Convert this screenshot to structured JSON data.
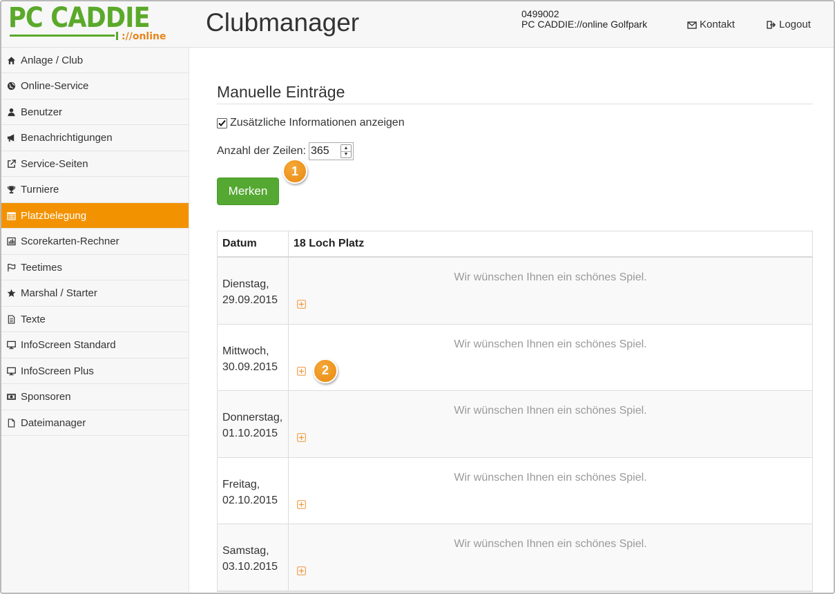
{
  "header": {
    "logo_main": "PC CADDIE",
    "logo_sub": "://online",
    "app_title": "Clubmanager",
    "club_id": "0499002",
    "club_name": "PC CADDIE://online Golfpark",
    "contact_label": "Kontakt",
    "logout_label": "Logout"
  },
  "sidebar": {
    "items": [
      {
        "label": "Anlage / Club",
        "icon": "home-icon"
      },
      {
        "label": "Online-Service",
        "icon": "globe-icon"
      },
      {
        "label": "Benutzer",
        "icon": "user-icon"
      },
      {
        "label": "Benachrichtigungen",
        "icon": "bullhorn-icon"
      },
      {
        "label": "Service-Seiten",
        "icon": "external-link-icon"
      },
      {
        "label": "Turniere",
        "icon": "trophy-icon"
      },
      {
        "label": "Platzbelegung",
        "icon": "calendar-icon",
        "active": true
      },
      {
        "label": "Scorekarten-Rechner",
        "icon": "bar-chart-icon"
      },
      {
        "label": "Teetimes",
        "icon": "flag-icon"
      },
      {
        "label": "Marshal / Starter",
        "icon": "star-icon"
      },
      {
        "label": "Texte",
        "icon": "document-icon"
      },
      {
        "label": "InfoScreen Standard",
        "icon": "monitor-icon"
      },
      {
        "label": "InfoScreen Plus",
        "icon": "monitor-icon"
      },
      {
        "label": "Sponsoren",
        "icon": "money-icon"
      },
      {
        "label": "Dateimanager",
        "icon": "file-icon"
      }
    ]
  },
  "main": {
    "title": "Manuelle Einträge",
    "show_info_label": "Zusätzliche Informationen anzeigen",
    "show_info_checked": true,
    "rows_label": "Anzahl der Zeilen:",
    "rows_value": "365",
    "save_label": "Merken",
    "badge_1": "1",
    "badge_2": "2",
    "table": {
      "headers": [
        "Datum",
        "18 Loch Platz"
      ],
      "rows": [
        {
          "day": "Dienstag,",
          "date": "29.09.2015",
          "message": "Wir wünschen Ihnen ein schönes Spiel."
        },
        {
          "day": "Mittwoch,",
          "date": "30.09.2015",
          "message": "Wir wünschen Ihnen ein schönes Spiel."
        },
        {
          "day": "Donnerstag,",
          "date": "01.10.2015",
          "message": "Wir wünschen Ihnen ein schönes Spiel."
        },
        {
          "day": "Freitag,",
          "date": "02.10.2015",
          "message": "Wir wünschen Ihnen ein schönes Spiel."
        },
        {
          "day": "Samstag,",
          "date": "03.10.2015",
          "message": "Wir wünschen Ihnen ein schönes Spiel."
        }
      ]
    }
  },
  "colors": {
    "brand_green": "#5aa92b",
    "brand_orange": "#e8851a",
    "active_orange": "#f39200",
    "button_green": "#55a832"
  }
}
